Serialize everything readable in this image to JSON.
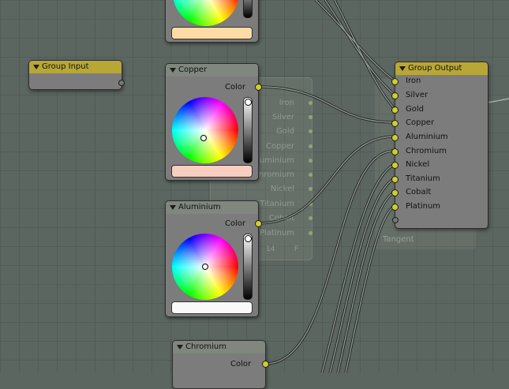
{
  "colors": {
    "socket": "#cfcf2a",
    "group_header": "#b8a737",
    "node_header": "#7f877f",
    "node_body": "#7c7c7c",
    "background": "#5c6660"
  },
  "nodes": {
    "top_partial": {
      "swatch_color": "#ffdca5"
    },
    "group_input": {
      "title": "Group Input"
    },
    "copper": {
      "title": "Copper",
      "output": "Color",
      "swatch_color": "#f8cec0"
    },
    "aluminium": {
      "title": "Aluminium",
      "output": "Color",
      "swatch_color": "#f9f9f9"
    },
    "chromium": {
      "title": "Chromium",
      "output": "Color"
    },
    "group_output": {
      "title": "Group Output",
      "inputs": [
        "Iron",
        "Silver",
        "Gold",
        "Copper",
        "Aluminium",
        "Chromium",
        "Nickel",
        "Titanium",
        "Cobalt",
        "Platinum"
      ]
    }
  },
  "ghost_node": {
    "labels": [
      "Iron",
      "Silver",
      "Gold",
      "Copper",
      "Aluminium",
      "Chromium",
      "Nickel",
      "Titanium",
      "Cobalt",
      "Platinum"
    ],
    "footer": "14",
    "footer_btn": "F"
  },
  "ghost_output": {
    "label": "Tangent"
  }
}
